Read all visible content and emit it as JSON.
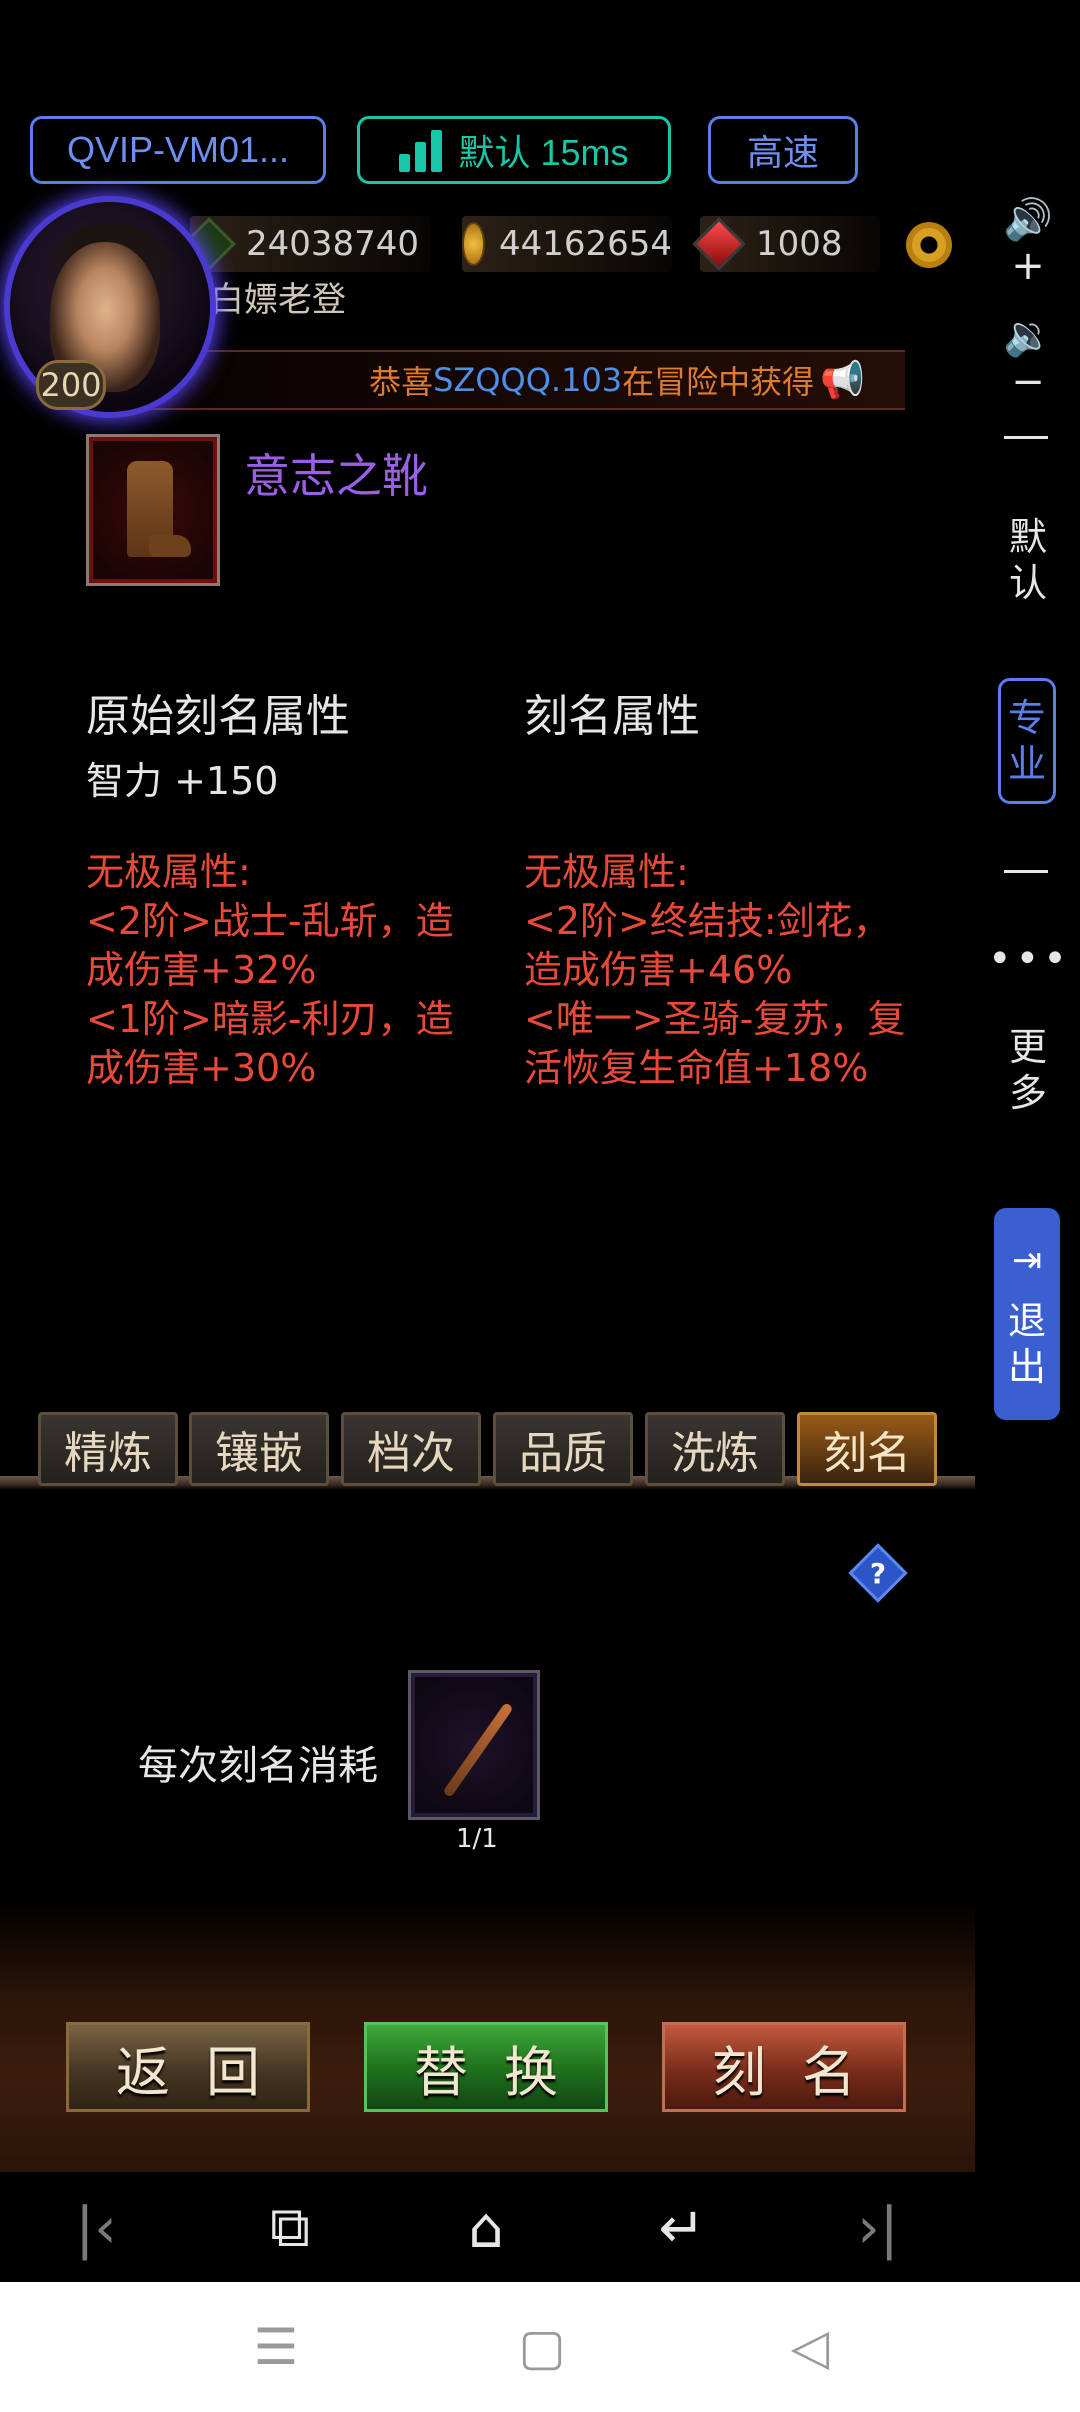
{
  "topbar": {
    "vip_label": "QVIP-VM01...",
    "ping_label": "默认 15ms",
    "speed_label": "高速"
  },
  "player": {
    "name": "白嫖老登",
    "level": "200",
    "stamina": "24038740",
    "gold": "44162654",
    "gems": "1008"
  },
  "marquee": {
    "prefix": "恭喜",
    "player": "SZQQQ.103",
    "suffix": "在冒险中获得"
  },
  "item": {
    "name": "意志之靴"
  },
  "original": {
    "header": "原始刻名属性",
    "attr": "智力 +150",
    "lines": [
      "无极属性:",
      "<2阶>战士-乱斩，造",
      "成伤害+32%",
      "<1阶>暗影-利刃，造",
      "成伤害+30%"
    ]
  },
  "engraved": {
    "header": "刻名属性",
    "lines": [
      "无极属性:",
      "<2阶>终结技:剑花，",
      "造成伤害+46%",
      "<唯一>圣骑-复苏，复",
      "活恢复生命值+18%"
    ]
  },
  "tabs": [
    "精炼",
    "镶嵌",
    "档次",
    "品质",
    "洗炼",
    "刻名"
  ],
  "active_tab": "刻名",
  "help_label": "?",
  "cost": {
    "label": "每次刻名消耗",
    "count": "1/1"
  },
  "actions": {
    "back": "返回",
    "swap": "替换",
    "engrave": "刻名"
  },
  "side_panel": {
    "default": "默认",
    "pro": "专业",
    "more": "更多",
    "exit": "退出"
  },
  "icons": {
    "vol_up": "volume-up-icon",
    "vol_down": "volume-down-icon",
    "settings": "gear-icon"
  },
  "colors": {
    "accent_blue": "#5b7ee8",
    "ping_green": "#18c7a8",
    "attr_red": "#e84a3a",
    "item_purple": "#9b5fe6"
  }
}
